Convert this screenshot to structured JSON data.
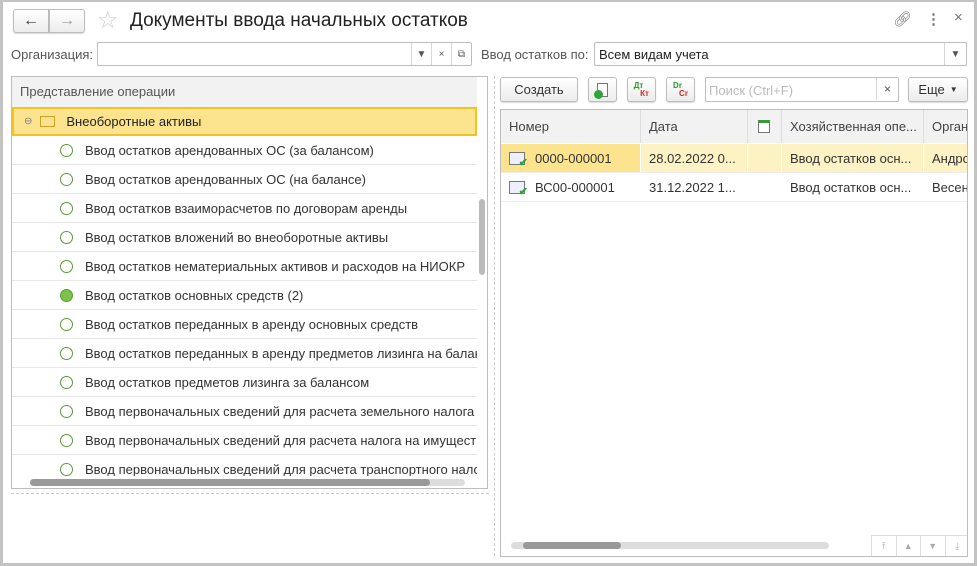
{
  "title": "Документы ввода начальных остатков",
  "filters": {
    "organization_label": "Организация:",
    "organization_value": "",
    "input_by_label": "Ввод остатков по:",
    "input_by_value": "Всем видам учета"
  },
  "tree": {
    "header": "Представление операции",
    "group": "Внеоборотные активы",
    "items": [
      {
        "label": "Ввод остатков арендованных ОС (за балансом)",
        "active": false
      },
      {
        "label": "Ввод остатков арендованных ОС (на балансе)",
        "active": false
      },
      {
        "label": "Ввод остатков взаиморасчетов по договорам аренды",
        "active": false
      },
      {
        "label": "Ввод остатков вложений во внеоборотные активы",
        "active": false
      },
      {
        "label": "Ввод остатков нематериальных активов и расходов на НИОКР",
        "active": false
      },
      {
        "label": "Ввод остатков основных средств (2)",
        "active": true
      },
      {
        "label": "Ввод остатков переданных в аренду основных средств",
        "active": false
      },
      {
        "label": "Ввод остатков переданных в аренду предметов лизинга на балансе",
        "active": false
      },
      {
        "label": "Ввод остатков предметов лизинга за балансом",
        "active": false
      },
      {
        "label": "Ввод первоначальных сведений для расчета земельного налога",
        "active": false
      },
      {
        "label": "Ввод первоначальных сведений для расчета налога на имущество",
        "active": false
      },
      {
        "label": "Ввод первоначальных сведений для расчета транспортного налога",
        "active": false
      }
    ]
  },
  "toolbar": {
    "create": "Создать",
    "dt_kt_top": "Дт",
    "dt_kt_bottom": "Кт",
    "dr_cr_top": "Dr",
    "dr_cr_bottom": "Cr",
    "search_placeholder": "Поиск (Ctrl+F)",
    "more": "Еще"
  },
  "table": {
    "columns": [
      "Номер",
      "Дата",
      "",
      "Хозяйственная опе...",
      "Организ"
    ],
    "rows": [
      {
        "number": "0000-000001",
        "date": "28.02.2022 0...",
        "op": "Ввод остатков осн...",
        "org": "Андропов"
      },
      {
        "number": "ВС00-000001",
        "date": "31.12.2022 1...",
        "op": "Ввод остатков осн...",
        "org": "Весенний"
      }
    ]
  }
}
